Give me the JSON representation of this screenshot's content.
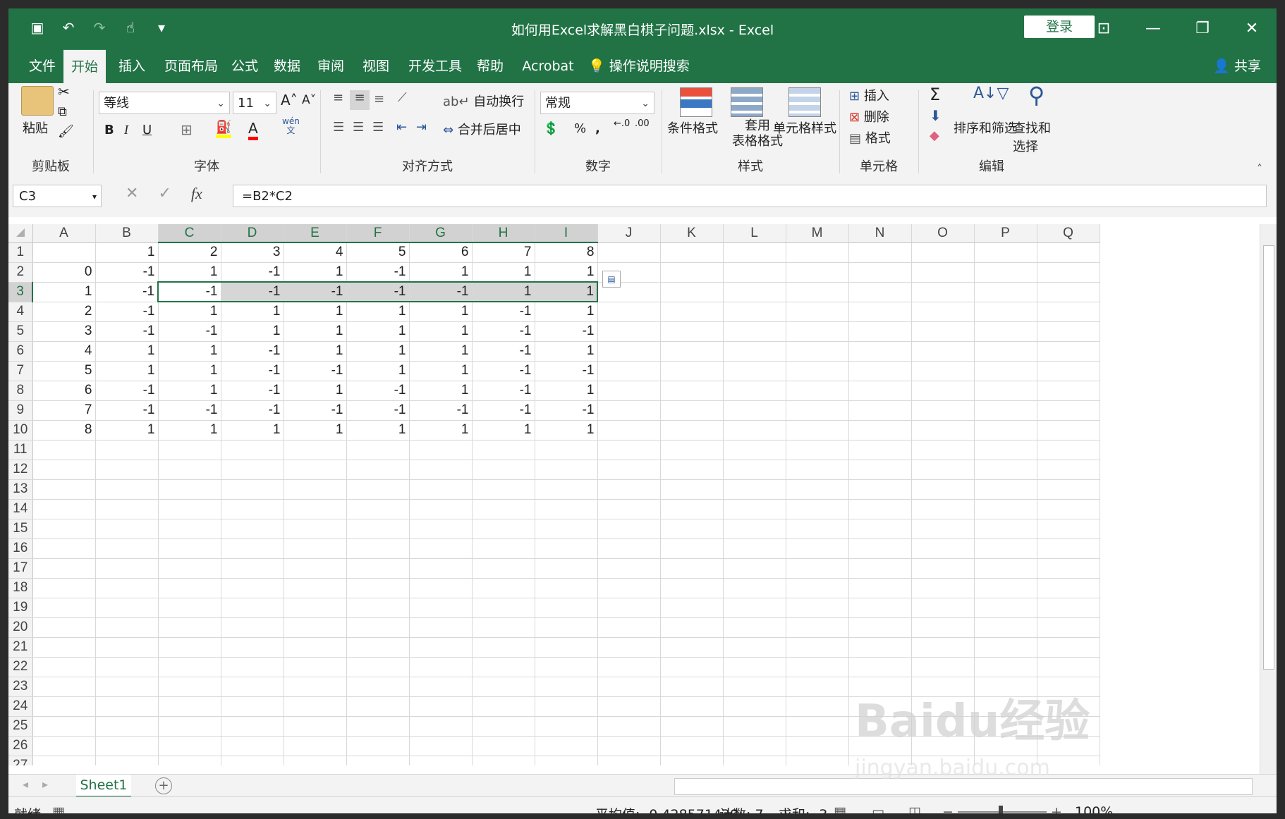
{
  "window": {
    "title": "如何用Excel求解黑白棋子问题.xlsx  -  Excel",
    "login_label": "登录",
    "share_label": "共享"
  },
  "tabs": [
    {
      "label": "文件"
    },
    {
      "label": "开始"
    },
    {
      "label": "插入"
    },
    {
      "label": "页面布局"
    },
    {
      "label": "公式"
    },
    {
      "label": "数据"
    },
    {
      "label": "审阅"
    },
    {
      "label": "视图"
    },
    {
      "label": "开发工具"
    },
    {
      "label": "帮助"
    },
    {
      "label": "Acrobat"
    },
    {
      "label": "操作说明搜索"
    }
  ],
  "ribbon": {
    "clipboard": {
      "paste": "粘贴",
      "group": "剪贴板"
    },
    "font": {
      "name": "等线",
      "size": "11",
      "group": "字体",
      "wen": "wén",
      "wen_char": "文"
    },
    "align": {
      "wrap": "自动换行",
      "merge": "合并后居中",
      "group": "对齐方式"
    },
    "number": {
      "format": "常规",
      "group": "数字"
    },
    "styles": {
      "cond": "条件格式",
      "table1": "套用",
      "table2": "表格格式",
      "cell": "单元格样式",
      "group": "样式"
    },
    "cells": {
      "insert": "插入",
      "delete": "删除",
      "format": "格式",
      "group": "单元格"
    },
    "edit": {
      "sort": "排序和筛选",
      "find": "查找和选择",
      "group": "编辑"
    }
  },
  "formula_bar": {
    "namebox": "C3",
    "formula": "=B2*C2"
  },
  "sheet": {
    "columns": [
      "A",
      "B",
      "C",
      "D",
      "E",
      "F",
      "G",
      "H",
      "I",
      "J",
      "K",
      "L",
      "M",
      "N",
      "O",
      "P",
      "Q"
    ],
    "rows": [
      [
        "",
        "1",
        "2",
        "3",
        "4",
        "5",
        "6",
        "7",
        "8"
      ],
      [
        "0",
        "-1",
        "1",
        "-1",
        "1",
        "-1",
        "1",
        "1",
        "1"
      ],
      [
        "1",
        "-1",
        "-1",
        "-1",
        "-1",
        "-1",
        "-1",
        "1",
        "1"
      ],
      [
        "2",
        "-1",
        "1",
        "1",
        "1",
        "1",
        "1",
        "-1",
        "1"
      ],
      [
        "3",
        "-1",
        "-1",
        "1",
        "1",
        "1",
        "1",
        "-1",
        "-1"
      ],
      [
        "4",
        "1",
        "1",
        "-1",
        "1",
        "1",
        "1",
        "-1",
        "1"
      ],
      [
        "5",
        "1",
        "1",
        "-1",
        "-1",
        "1",
        "1",
        "-1",
        "-1"
      ],
      [
        "6",
        "-1",
        "1",
        "-1",
        "1",
        "-1",
        "1",
        "-1",
        "1"
      ],
      [
        "7",
        "-1",
        "-1",
        "-1",
        "-1",
        "-1",
        "-1",
        "-1",
        "-1"
      ],
      [
        "8",
        "1",
        "1",
        "1",
        "1",
        "1",
        "1",
        "1",
        "1"
      ]
    ],
    "total_rows": 27,
    "tab_name": "Sheet1"
  },
  "status": {
    "ready": "就绪",
    "average": "平均值: -0.428571429",
    "count": "计数: 7",
    "sum": "求和: -3",
    "zoom": "100%"
  },
  "watermark": {
    "brand": "Baidu经验",
    "url": "jingyan.baidu.com"
  }
}
